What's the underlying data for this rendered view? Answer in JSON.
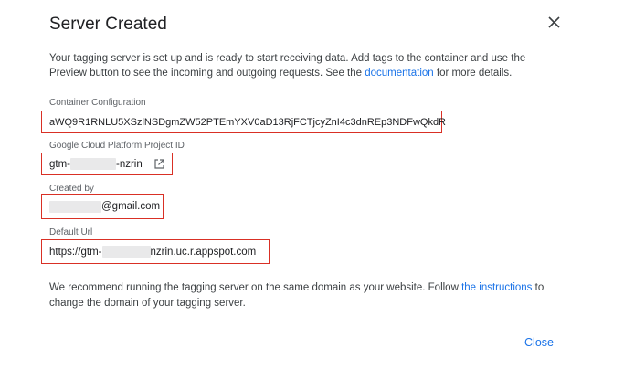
{
  "dialog": {
    "title": "Server Created",
    "description_pre": "Your tagging server is set up and is ready to start receiving data. Add tags to the container and use the Preview button to see the incoming and outgoing requests. See the ",
    "description_link": "documentation",
    "description_post": " for more details.",
    "fields": {
      "container_configuration": {
        "label": "Container Configuration",
        "value": "aWQ9R1RNLU5XSzlNSDgmZW52PTEmYXV0aD13RjFCTjcyZnI4c3dnREp3NDFwQkdR"
      },
      "gcp_project_id": {
        "label": "Google Cloud Platform Project ID",
        "value_prefix": "gtm-",
        "value_suffix": "-nzrin",
        "icon": "open-in-new-icon"
      },
      "created_by": {
        "label": "Created by",
        "value_suffix": "@gmail.com"
      },
      "default_url": {
        "label": "Default Url",
        "value_prefix": "https://gtm-",
        "value_suffix": "nzrin.uc.r.appspot.com"
      }
    },
    "bottom_pre": "We recommend running the tagging server on the same domain as your website. Follow ",
    "bottom_link": "the instructions",
    "bottom_post": " to change the domain of your tagging server.",
    "close_label": "Close",
    "colors": {
      "accent": "#1a73e8",
      "highlight_border": "#d93025"
    }
  }
}
